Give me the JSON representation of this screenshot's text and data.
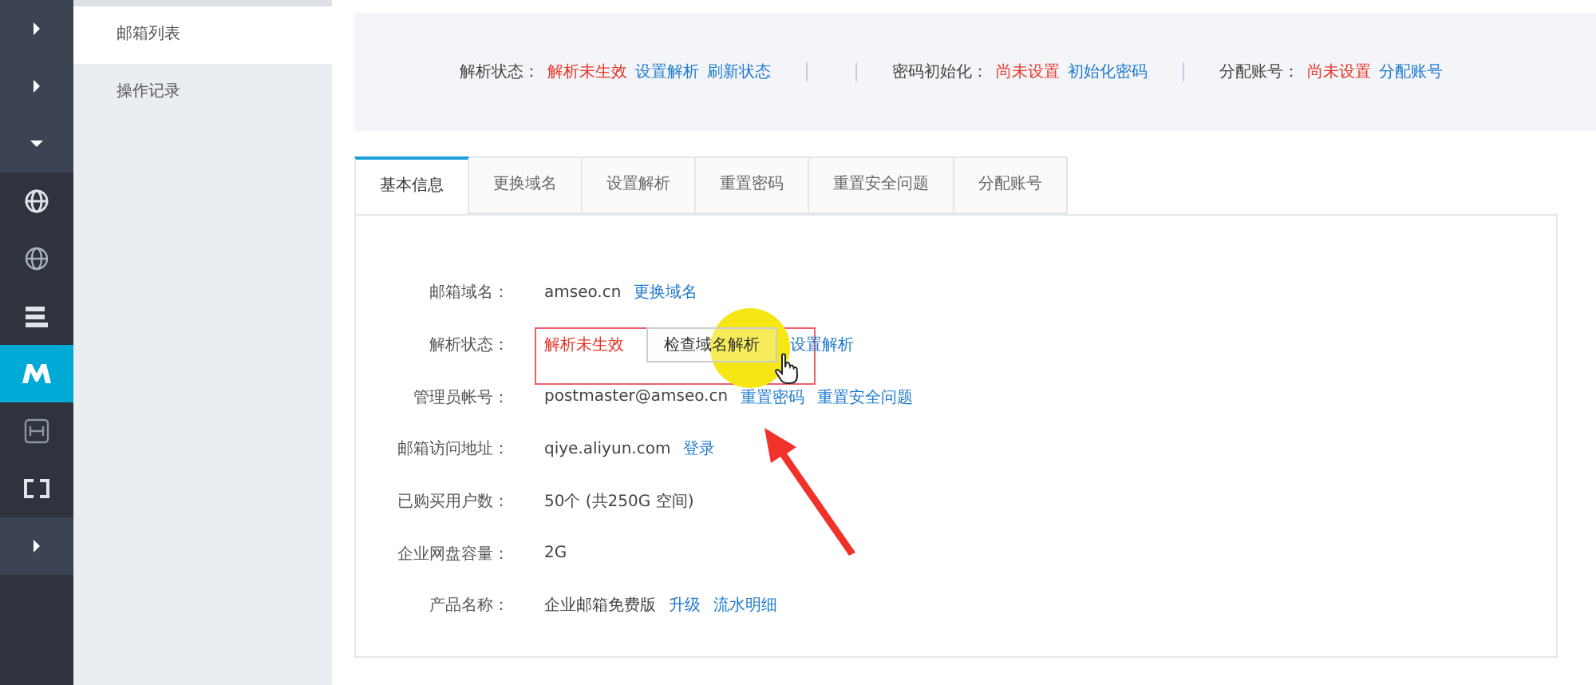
{
  "rail": [
    {
      "kind": "arrow-right",
      "shaded": true,
      "selected": false
    },
    {
      "kind": "arrow-right",
      "shaded": true,
      "selected": false
    },
    {
      "kind": "arrow-down",
      "shaded": true,
      "selected": false
    },
    {
      "kind": "globe",
      "shaded": false,
      "selected": false
    },
    {
      "kind": "dns",
      "shaded": false,
      "selected": false
    },
    {
      "kind": "server",
      "shaded": false,
      "selected": false
    },
    {
      "kind": "mail-m",
      "shaded": false,
      "selected": true
    },
    {
      "kind": "mail-box",
      "shaded": false,
      "selected": false
    },
    {
      "kind": "bracket",
      "shaded": false,
      "selected": false
    },
    {
      "kind": "arrow-right",
      "shaded": true,
      "selected": false
    }
  ],
  "sidebar": {
    "items": [
      {
        "label": "邮箱列表",
        "selected": true
      },
      {
        "label": "操作记录",
        "selected": false
      }
    ]
  },
  "status_panel": [
    {
      "label": "解析状态：",
      "parts": [
        {
          "kind": "error",
          "text": "解析未生效"
        },
        {
          "kind": "link",
          "text": "设置解析"
        },
        {
          "kind": "link",
          "text": "刷新状态"
        }
      ]
    },
    {
      "label": "密码初始化：",
      "parts": [
        {
          "kind": "error",
          "text": "尚未设置"
        },
        {
          "kind": "link",
          "text": "初始化密码"
        }
      ]
    },
    {
      "label": "分配账号：",
      "parts": [
        {
          "kind": "error",
          "text": "尚未设置"
        },
        {
          "kind": "link",
          "text": "分配账号"
        }
      ]
    }
  ],
  "tabs": [
    {
      "label": "基本信息",
      "selected": true
    },
    {
      "label": "更换域名",
      "selected": false
    },
    {
      "label": "设置解析",
      "selected": false
    },
    {
      "label": "重置密码",
      "selected": false
    },
    {
      "label": "重置安全问题",
      "selected": false
    },
    {
      "label": "分配账号",
      "selected": false
    }
  ],
  "info": [
    {
      "label": "邮箱域名：",
      "parts": [
        {
          "kind": "text",
          "text": "amseo.cn"
        },
        {
          "kind": "link",
          "text": "更换域名"
        }
      ]
    },
    {
      "label": "解析状态：",
      "parts": [
        {
          "kind": "error",
          "text": "解析未生效"
        },
        {
          "kind": "button",
          "text": "检查域名解析"
        },
        {
          "kind": "link",
          "text": "设置解析"
        }
      ]
    },
    {
      "label": "管理员帐号：",
      "parts": [
        {
          "kind": "text",
          "text": "postmaster@amseo.cn"
        },
        {
          "kind": "link",
          "text": "重置密码"
        },
        {
          "kind": "link",
          "text": "重置安全问题"
        }
      ]
    },
    {
      "label": "邮箱访问地址：",
      "parts": [
        {
          "kind": "text",
          "text": "qiye.aliyun.com"
        },
        {
          "kind": "link",
          "text": "登录"
        }
      ]
    },
    {
      "label": "已购买用户数：",
      "parts": [
        {
          "kind": "text",
          "text": "50个 (共250G 空间)"
        }
      ]
    },
    {
      "label": "企业网盘容量：",
      "parts": [
        {
          "kind": "text",
          "text": "2G"
        }
      ]
    },
    {
      "label": "产品名称：",
      "parts": [
        {
          "kind": "text",
          "text": "企业邮箱免费版"
        },
        {
          "kind": "link",
          "text": "升级"
        },
        {
          "kind": "link",
          "text": "流水明细"
        }
      ]
    }
  ]
}
